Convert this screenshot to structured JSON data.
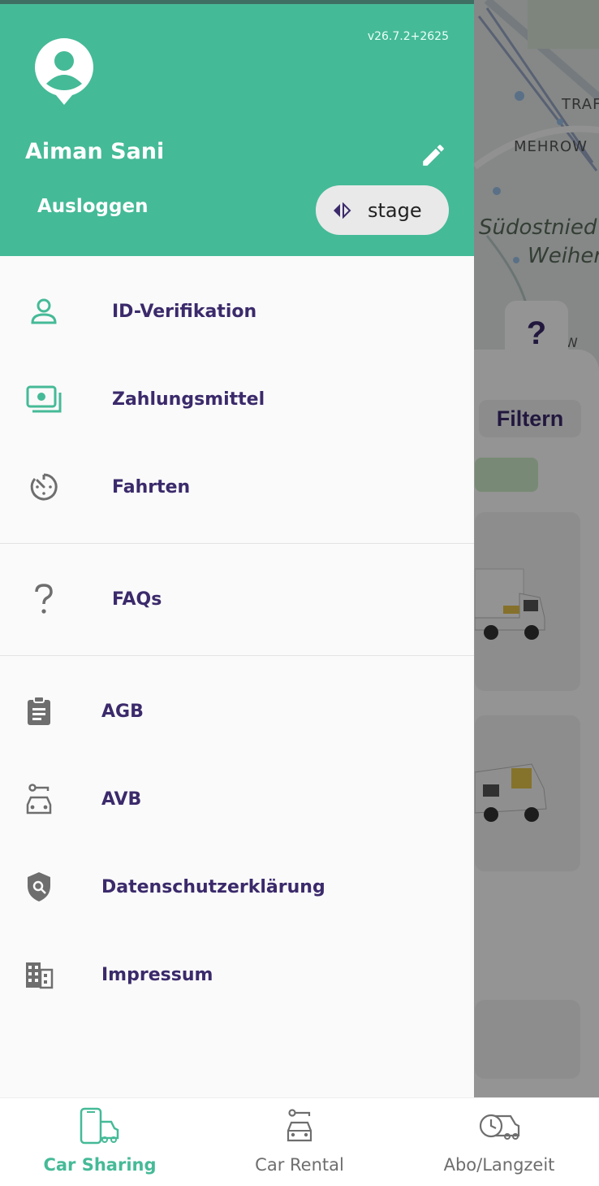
{
  "background": {
    "map_labels": [
      "TRAF",
      "MEHROW",
      "Südostnied",
      "Weiher",
      "W"
    ],
    "help_button": "?",
    "filter_label": "Filtern"
  },
  "drawer": {
    "version": "v26.7.2+2625",
    "user_name": "Aiman Sani",
    "logout_label": "Ausloggen",
    "environment_label": "stage",
    "main_items": [
      {
        "label": "ID-Verifikation",
        "icon": "person-outline-icon"
      },
      {
        "label": "Zahlungsmittel",
        "icon": "payment-icon"
      },
      {
        "label": "Fahrten",
        "icon": "timer-icon"
      }
    ],
    "faq": {
      "label": "FAQs",
      "icon": "question-mark-icon"
    },
    "legal_items": [
      {
        "label": "AGB",
        "icon": "clipboard-icon"
      },
      {
        "label": "AVB",
        "icon": "car-key-icon"
      },
      {
        "label": "Datenschutzerklärung",
        "icon": "shield-search-icon"
      },
      {
        "label": "Impressum",
        "icon": "building-icon"
      }
    ]
  },
  "bottom_nav": {
    "items": [
      {
        "label": "Car Sharing",
        "icon": "phone-car-icon",
        "active": true
      },
      {
        "label": "Car Rental",
        "icon": "car-key-icon",
        "active": false
      },
      {
        "label": "Abo/Langzeit",
        "icon": "car-clock-icon",
        "active": false
      }
    ]
  },
  "colors": {
    "brand_green": "#45ba97",
    "brand_purple": "#3b2a6b",
    "drawer_bg": "#fafafa"
  }
}
